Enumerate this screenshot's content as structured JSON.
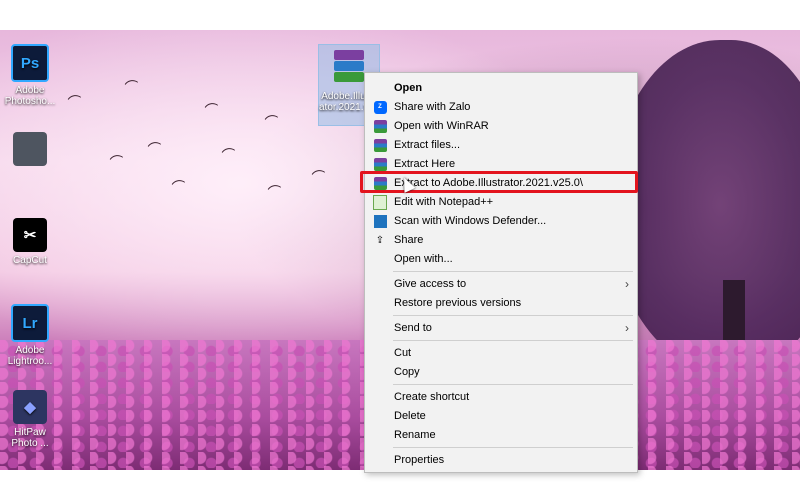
{
  "desktop": {
    "icons": [
      {
        "label": "Adobe Photosho...",
        "glyph": "Ps",
        "kind": "photoshop-icon"
      },
      {
        "label": "",
        "glyph": "",
        "kind": "app-icon"
      },
      {
        "label": "CapCut",
        "glyph": "✂",
        "kind": "capcut-icon"
      },
      {
        "label": "Adobe Lightroo...",
        "glyph": "Lr",
        "kind": "lightroom-icon"
      },
      {
        "label": "HitPaw Photo ...",
        "glyph": "◆",
        "kind": "hitpaw-icon"
      }
    ],
    "selected_file": {
      "label": "Adobe.Illustr ator.2021.v25.0.rar"
    }
  },
  "context_menu": {
    "items": [
      {
        "label": "Open",
        "icon": "",
        "bold": true
      },
      {
        "label": "Share with Zalo",
        "icon": "zalo-icon"
      },
      {
        "label": "Open with WinRAR",
        "icon": "winrar-icon"
      },
      {
        "label": "Extract files...",
        "icon": "winrar-icon"
      },
      {
        "label": "Extract Here",
        "icon": "winrar-icon"
      },
      {
        "label": "Extract to Adobe.Illustrator.2021.v25.0\\",
        "icon": "winrar-icon",
        "highlighted": true
      },
      {
        "label": "Edit with Notepad++",
        "icon": "notepadpp-icon"
      },
      {
        "label": "Scan with Windows Defender...",
        "icon": "defender-icon"
      },
      {
        "label": "Share",
        "icon": "share-icon"
      },
      {
        "label": "Open with...",
        "icon": ""
      },
      {
        "label": "Give access to",
        "icon": "",
        "submenu": true
      },
      {
        "label": "Restore previous versions",
        "icon": ""
      },
      {
        "label": "Send to",
        "icon": "",
        "submenu": true
      },
      {
        "label": "Cut",
        "icon": ""
      },
      {
        "label": "Copy",
        "icon": ""
      },
      {
        "label": "Create shortcut",
        "icon": ""
      },
      {
        "label": "Delete",
        "icon": ""
      },
      {
        "label": "Rename",
        "icon": ""
      },
      {
        "label": "Properties",
        "icon": ""
      }
    ],
    "highlight_color": "#e3141e"
  }
}
